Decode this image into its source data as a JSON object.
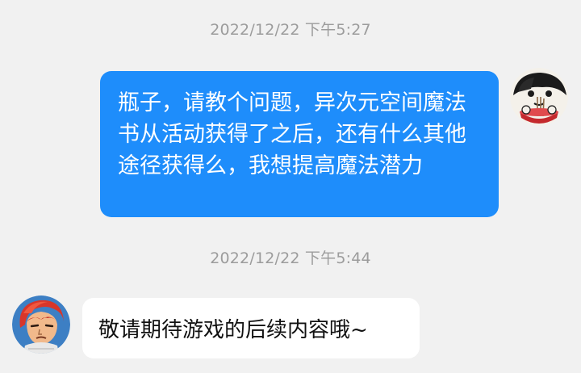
{
  "chat": {
    "messages": [
      {
        "timestamp": "2022/12/22 下午5:27",
        "direction": "outgoing",
        "text": "瓶子，请教个问题，异次元空间魔法书从活动获得了之后，还有什么其他途径获得么，我想提高魔法潜力",
        "avatar_icon": "cartoon-person-eating-noodles-avatar"
      },
      {
        "timestamp": "2022/12/22 下午5:44",
        "direction": "incoming",
        "text": "敬请期待游戏的后续内容哦~",
        "avatar_icon": "anime-red-hair-character-avatar"
      }
    ]
  },
  "colors": {
    "background": "#f1f1f1",
    "outgoing_bubble": "#1e8dfb",
    "incoming_bubble": "#ffffff",
    "timestamp_text": "#9c9c9c"
  }
}
